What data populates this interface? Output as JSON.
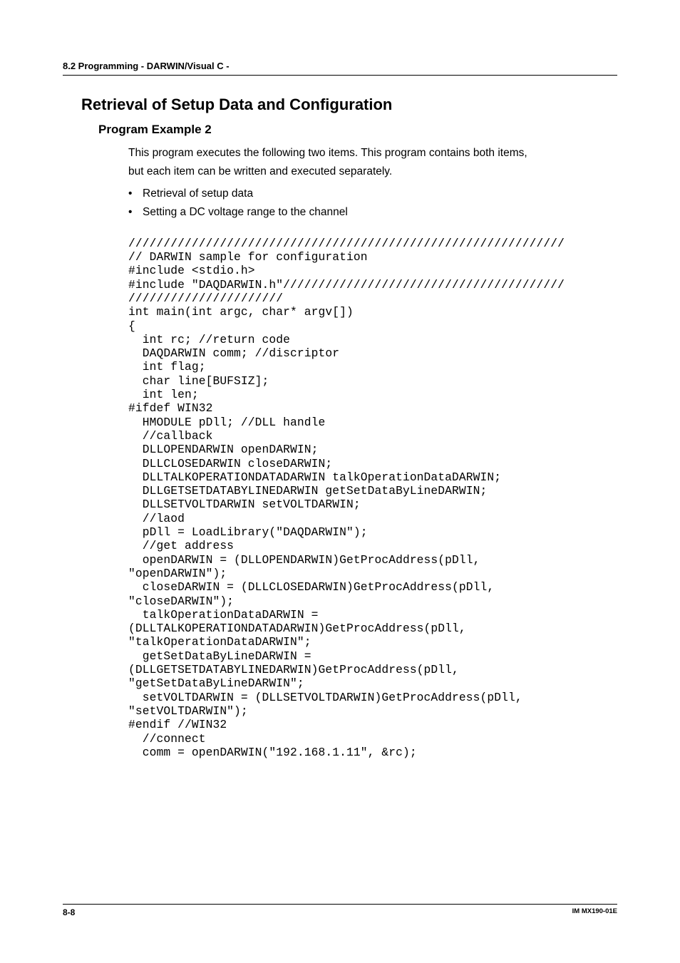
{
  "header": {
    "section": "8.2  Programming - DARWIN/Visual C -"
  },
  "titles": {
    "h1": "Retrieval of Setup Data and Configuration",
    "h2": "Program Example 2"
  },
  "paragraphs": {
    "line1": "This program executes the following two items. This program contains both items,",
    "line2": "but each item can be written and executed separately."
  },
  "bullets": {
    "b1": "Retrieval of setup data",
    "b2": "Setting a DC voltage range to the channel"
  },
  "code": "//////////////////////////////////////////////////////////////\n// DARWIN sample for configuration\n#include <stdio.h>\n#include \"DAQDARWIN.h\"////////////////////////////////////////\n//////////////////////\nint main(int argc, char* argv[])\n{\n  int rc; //return code\n  DAQDARWIN comm; //discriptor\n  int flag;\n  char line[BUFSIZ];\n  int len;\n#ifdef WIN32\n  HMODULE pDll; //DLL handle\n  //callback\n  DLLOPENDARWIN openDARWIN;\n  DLLCLOSEDARWIN closeDARWIN;\n  DLLTALKOPERATIONDATADARWIN talkOperationDataDARWIN;\n  DLLGETSETDATABYLINEDARWIN getSetDataByLineDARWIN;\n  DLLSETVOLTDARWIN setVOLTDARWIN;\n  //laod\n  pDll = LoadLibrary(\"DAQDARWIN\");\n  //get address\n  openDARWIN = (DLLOPENDARWIN)GetProcAddress(pDll,\n\"openDARWIN\");\n  closeDARWIN = (DLLCLOSEDARWIN)GetProcAddress(pDll,\n\"closeDARWIN\");\n  talkOperationDataDARWIN =\n(DLLTALKOPERATIONDATADARWIN)GetProcAddress(pDll,\n\"talkOperationDataDARWIN\";\n  getSetDataByLineDARWIN =\n(DLLGETSETDATABYLINEDARWIN)GetProcAddress(pDll,\n\"getSetDataByLineDARWIN\";\n  setVOLTDARWIN = (DLLSETVOLTDARWIN)GetProcAddress(pDll,\n\"setVOLTDARWIN\");\n#endif //WIN32\n  //connect\n  comm = openDARWIN(\"192.168.1.11\", &rc);",
  "footer": {
    "page": "8-8",
    "docid": "IM MX190-01E"
  }
}
